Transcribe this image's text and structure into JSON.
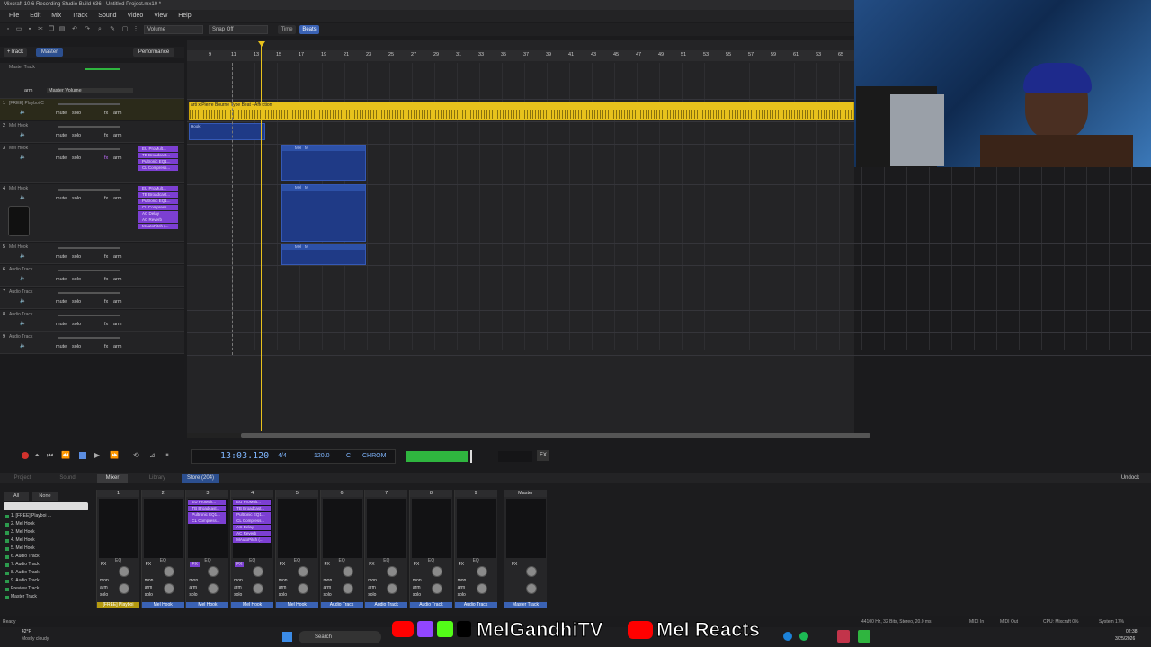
{
  "app": {
    "title": "Mixcraft 10.6 Recording Studio Build 636 - Untitled Project.mx10 *"
  },
  "menu": [
    "File",
    "Edit",
    "Mix",
    "Track",
    "Sound",
    "Video",
    "View",
    "Help"
  ],
  "toolbar": {
    "mode_combo": "Volume",
    "snap_combo": "Snap Off",
    "time_btn": "Time",
    "beats_btn": "Beats"
  },
  "trackpanel": {
    "add_track": "+Track",
    "master_btn": "Master",
    "performance_btn": "Performance",
    "master_volume": "Master Volume",
    "arm": "arm",
    "mute": "mute",
    "solo": "solo"
  },
  "tracks": [
    {
      "num": "",
      "name": "Master Track"
    },
    {
      "num": "1",
      "name": "[FREE] Playboi C"
    },
    {
      "num": "2",
      "name": "Mel Hook"
    },
    {
      "num": "3",
      "name": "Mel Hook"
    },
    {
      "num": "4",
      "name": "Mel Hook"
    },
    {
      "num": "5",
      "name": "Mel Hook"
    },
    {
      "num": "6",
      "name": "Audio Track"
    },
    {
      "num": "7",
      "name": "Audio Track"
    },
    {
      "num": "8",
      "name": "Audio Track"
    },
    {
      "num": "9",
      "name": "Audio Track"
    }
  ],
  "plugins": {
    "track3": [
      "EU ProMult...",
      "TB Broadcast...",
      "Pultronic EQ1...",
      "CL Compress..."
    ],
    "track4": [
      "EU ProMult...",
      "TB Broadcast...",
      "Pultronic EQ1...",
      "CL Compress...",
      "AC Delay",
      "AC Reverb",
      "MAutoPitch (..."
    ]
  },
  "ruler_ticks": [
    "9",
    "11",
    "13",
    "15",
    "17",
    "19",
    "21",
    "23",
    "25",
    "27",
    "29",
    "31",
    "33",
    "35",
    "37",
    "39",
    "41",
    "43",
    "45",
    "47",
    "49",
    "51",
    "53",
    "55",
    "57",
    "59",
    "61",
    "63",
    "65"
  ],
  "clips": {
    "beat": "arti x Pierre Bourne Type Beat - Affection",
    "hook": "Hook",
    "mel": "Mel",
    "m": "M"
  },
  "transport": {
    "time": "13:03.120",
    "meter": "4/4",
    "tempo": "120.0",
    "key": "C",
    "scale": "CHROM",
    "fx": "FX"
  },
  "tabs": [
    "Project",
    "Sound",
    "Mixer",
    "Library",
    "Store (204)"
  ],
  "undock": "Undock",
  "mixer": {
    "all": "All",
    "none": "None",
    "list": [
      "1. [FREE] Playboi ...",
      "2. Mel Hook",
      "3. Mel Hook",
      "4. Mel Hook",
      "5. Mel Hook",
      "6. Audio Track",
      "7. Audio Track",
      "8. Audio Track",
      "9. Audio Track",
      "Preview Track",
      "Master Track"
    ],
    "strips": [
      {
        "num": "1",
        "name": "[FREE] Playboi",
        "fxon": false
      },
      {
        "num": "2",
        "name": "Mel Hook",
        "fxon": false
      },
      {
        "num": "3",
        "name": "Mel Hook",
        "fxon": true
      },
      {
        "num": "4",
        "name": "Mel Hook",
        "fxon": true
      },
      {
        "num": "5",
        "name": "Mel Hook",
        "fxon": false
      },
      {
        "num": "6",
        "name": "Audio Track",
        "fxon": false
      },
      {
        "num": "7",
        "name": "Audio Track",
        "fxon": false
      },
      {
        "num": "8",
        "name": "Audio Track",
        "fxon": false
      },
      {
        "num": "9",
        "name": "Audio Track",
        "fxon": false
      }
    ],
    "master_label": "Master",
    "master_name": "Master Track",
    "fx": "FX",
    "eq": "EQ",
    "mon": "mon",
    "arm": "arm",
    "solo": "solo"
  },
  "status": {
    "left": "Ready",
    "audio": "44100 Hz, 32 Bits, Stereo, 20.0 ms",
    "midi_in": "MIDI In",
    "midi_out": "MIDI Out",
    "cpu": "CPU: Mixcraft 0%",
    "system": "System 17%"
  },
  "taskbar": {
    "weather_temp": "42°F",
    "weather_desc": "Mostly cloudy",
    "search": "Search",
    "time": "02:38",
    "date": "3/25/2026"
  },
  "overlay": {
    "channel1": "MelGandhiTV",
    "channel2": "Mel Reacts"
  },
  "colors": {
    "accent": "#e8c21c",
    "clip_blue": "#2d51a8",
    "plugin_purple": "#7c3fd2",
    "track_name_blue": "#3a62b4"
  }
}
